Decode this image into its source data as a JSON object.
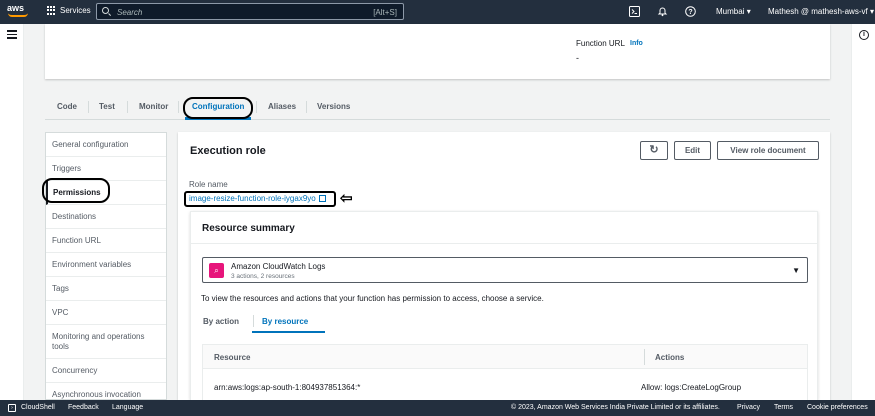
{
  "topbar": {
    "logo_text": "aws",
    "services_label": "Services",
    "search_placeholder": "Search",
    "search_shortcut": "[Alt+S]",
    "region": "Mumbai",
    "account": "Mathesh @ mathesh-aws-vf",
    "icons": [
      "cloudshell-icon",
      "bell-icon",
      "help-icon"
    ]
  },
  "top_card": {
    "function_url_label": "Function URL",
    "info_label": "Info",
    "function_url_value": "-"
  },
  "tabs": [
    {
      "label": "Code"
    },
    {
      "label": "Test"
    },
    {
      "label": "Monitor"
    },
    {
      "label": "Configuration",
      "active": true
    },
    {
      "label": "Aliases"
    },
    {
      "label": "Versions"
    }
  ],
  "sidenav": [
    {
      "label": "General configuration"
    },
    {
      "label": "Triggers"
    },
    {
      "label": "Permissions",
      "active": true
    },
    {
      "label": "Destinations"
    },
    {
      "label": "Function URL"
    },
    {
      "label": "Environment variables"
    },
    {
      "label": "Tags"
    },
    {
      "label": "VPC"
    },
    {
      "label": "Monitoring and operations tools"
    },
    {
      "label": "Concurrency"
    },
    {
      "label": "Asynchronous invocation"
    }
  ],
  "execution_role": {
    "title": "Execution role",
    "edit_label": "Edit",
    "view_doc_label": "View role document",
    "role_name_label": "Role name",
    "role_name": "image-resize-function-role-iygax9yo"
  },
  "resource_summary": {
    "title": "Resource summary",
    "selected_service": "Amazon CloudWatch Logs",
    "selected_service_sub": "3 actions, 2 resources",
    "hint": "To view the resources and actions that your function has permission to access, choose a service.",
    "subtabs": [
      {
        "label": "By action"
      },
      {
        "label": "By resource",
        "active": true
      }
    ],
    "table": {
      "headers": [
        "Resource",
        "Actions"
      ],
      "rows": [
        [
          "arn:aws:logs:ap-south-1:804937851364:*",
          "Allow: logs:CreateLogGroup"
        ]
      ]
    }
  },
  "bottombar": {
    "cloudshell": "CloudShell",
    "feedback": "Feedback",
    "language": "Language",
    "copyright": "© 2023, Amazon Web Services India Private Limited or its affiliates.",
    "privacy": "Privacy",
    "terms": "Terms",
    "cookies": "Cookie preferences"
  },
  "colors": {
    "topbar": "#232f3e",
    "accent": "#ff9900",
    "link": "#0073bb",
    "service_icon": "#e7157b"
  }
}
